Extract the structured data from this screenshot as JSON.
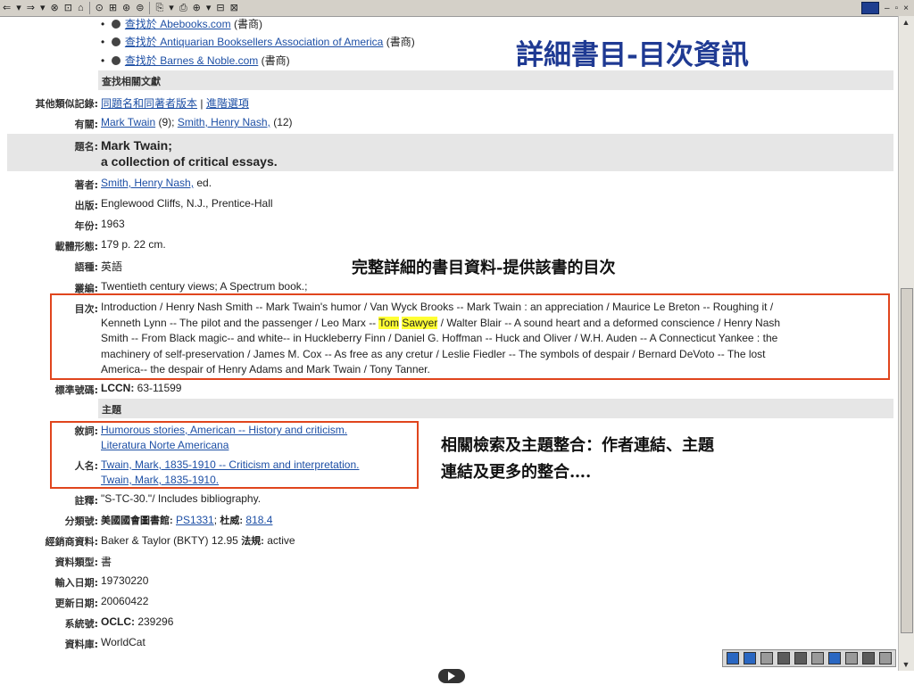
{
  "toolbar": {
    "items": [
      "⇐",
      "▾",
      "⇒",
      "▾",
      "⊗",
      "⊡",
      "⌂",
      "⊙",
      "⊞",
      "⊛",
      "⊜",
      "⎘",
      "▾",
      "⎙",
      "⊕",
      "▾",
      "⊟",
      "⊠"
    ],
    "window_controls": [
      "–",
      "▫",
      "×"
    ]
  },
  "title_text": "詳細書目-目次資訊",
  "annotations": {
    "full_record": "完整詳細的書目資料-提供該書的目次",
    "subjects_line1": "相關檢索及主題整合：作者連結、主題",
    "subjects_line2": "連結及更多的整合…."
  },
  "find_links": [
    {
      "link": "查找於 Abebooks.com",
      "type": "(書商)"
    },
    {
      "link": "查找於 Antiquarian Booksellers Association of America",
      "type": "(書商)"
    },
    {
      "link": "查找於 Barnes & Noble.com",
      "type": "(書商)"
    }
  ],
  "section_related": "查找相關文獻",
  "section_subject": "主題",
  "labels": {
    "similar": "其他類似記錄",
    "about": "有關",
    "title": "題名",
    "author": "著者",
    "publication": "出版",
    "year": "年份",
    "physical": "載體形態",
    "language": "語種",
    "series": "叢編",
    "contents": "目次",
    "standard": "標準號碼",
    "descriptor": "敘詞",
    "personal": "人名",
    "note": "註釋",
    "classification": "分類號",
    "vendor": "經銷商資料",
    "material": "資料類型",
    "entered": "輸入日期",
    "updated": "更新日期",
    "system": "系統號",
    "database": "資料庫"
  },
  "values": {
    "similar_link1": "同題名和同著者版本",
    "similar_sep": " | ",
    "similar_link2": "進階選項",
    "about_link1": "Mark Twain",
    "about_count1": " (9); ",
    "about_link2": "Smith, Henry Nash,",
    "about_count2": " (12)",
    "title_line1": "Mark Twain;",
    "title_line2": "a collection of critical essays.",
    "author_link": "Smith, Henry Nash,",
    "author_role": " ed.",
    "publication": "Englewood Cliffs, N.J., Prentice-Hall",
    "year": "1963",
    "physical": "179 p. 22 cm.",
    "language": "英語",
    "series": "Twentieth century views; A Spectrum book.;",
    "contents_l1": "Introduction / Henry Nash Smith -- Mark Twain's humor / Van Wyck Brooks -- Mark Twain : an appreciation / Maurice Le Breton -- Roughing it /",
    "contents_l2a": "Kenneth Lynn -- The pilot and the passenger / Leo Marx -- ",
    "contents_hl1": "Tom",
    "contents_space": " ",
    "contents_hl2": "Sawyer",
    "contents_l2b": " / Walter Blair -- A sound heart and a deformed conscience / Henry Nash",
    "contents_l3": "Smith -- From Black magic-- and white-- in Huckleberry Finn / Daniel G. Hoffman -- Huck and Oliver / W.H. Auden -- A Connecticut Yankee : the",
    "contents_l4": "machinery of self-preservation / James M. Cox -- As free as any cretur / Leslie Fiedler -- The symbols of despair / Bernard DeVoto -- The lost",
    "contents_l5": "America-- the despair of Henry Adams and Mark Twain / Tony Tanner.",
    "lccn_label": "LCCN:",
    "lccn": " 63-11599",
    "descriptor1": "Humorous stories, American -- History and criticism.",
    "descriptor2": "Literatura Norte Americana",
    "personal1": "Twain, Mark, 1835-1910 -- Criticism and interpretation.",
    "personal2": "Twain, Mark, 1835-1910.",
    "note": "\"S-TC-30.\"/ Includes bibliography.",
    "class_label1": "美國國會圖書館:",
    "class_link1": "PS1331",
    "class_sep": "; ",
    "class_label2": "杜威:",
    "class_link2": "818.4",
    "vendor": "Baker & Taylor (BKTY) 12.95 ",
    "vendor_label": "法規:",
    "vendor_status": " active",
    "material": "書",
    "entered": "19730220",
    "updated": "20060422",
    "oclc_label": "OCLC:",
    "oclc": " 239296",
    "database": "WorldCat"
  },
  "colors": {
    "title": "#1f3a93",
    "link": "#1d4fa5",
    "highlight": "#ffff33",
    "redbox": "#e0451d",
    "shade": "#e6e6e6"
  }
}
